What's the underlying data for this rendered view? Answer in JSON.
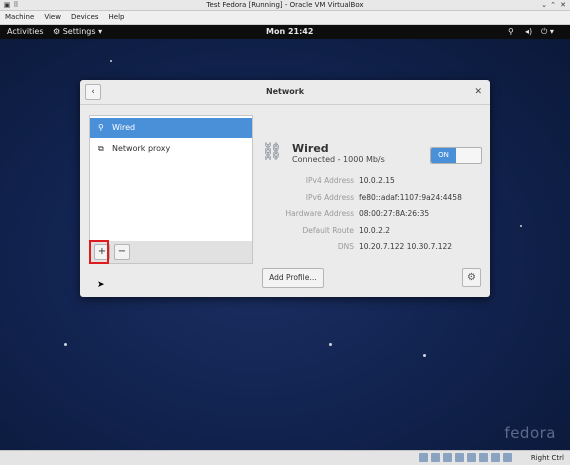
{
  "host": {
    "title": "Test Fedora [Running] - Oracle VM VirtualBox",
    "menu": [
      "Machine",
      "View",
      "Devices",
      "Help"
    ],
    "host_key": "Right Ctrl"
  },
  "topbar": {
    "activities": "Activities",
    "app_menu": "Settings",
    "clock": "Mon 21:42"
  },
  "dialog": {
    "title": "Network",
    "list_items": [
      {
        "label": "Wired",
        "icon": "network-wired-icon",
        "selected": true
      },
      {
        "label": "Network proxy",
        "icon": "network-proxy-icon",
        "selected": false
      }
    ],
    "add_label": "+",
    "remove_label": "−",
    "connection": {
      "name": "Wired",
      "status": "Connected - 1000 Mb/s",
      "toggle": "ON"
    },
    "properties": [
      {
        "key": "IPv4 Address",
        "value": "10.0.2.15"
      },
      {
        "key": "IPv6 Address",
        "value": "fe80::adaf:1107:9a24:4458"
      },
      {
        "key": "Hardware Address",
        "value": "08:00:27:8A:26:35"
      },
      {
        "key": "Default Route",
        "value": "10.0.2.2"
      },
      {
        "key": "DNS",
        "value": "10.20.7.122 10.30.7.122"
      }
    ],
    "add_profile": "Add Profile…"
  },
  "desktop": {
    "brand": "fedora"
  },
  "colors": {
    "accent": "#4a90d9",
    "highlight": "#e01b1b"
  }
}
